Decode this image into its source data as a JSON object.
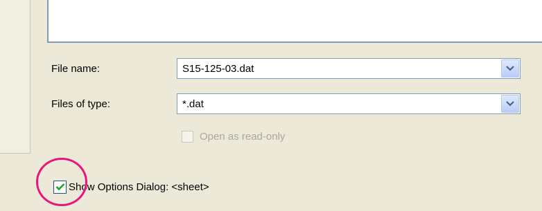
{
  "dialog": {
    "file_name_label": "File name:",
    "file_name_value": "S15-125-03.dat",
    "files_of_type_label": "Files of type:",
    "files_of_type_value": "*.dat",
    "open_readonly_label": "Open as read-only",
    "open_readonly_checked": false,
    "open_readonly_enabled": false,
    "show_options_label": "Show Options Dialog: <sheet>",
    "show_options_checked": true
  },
  "colors": {
    "background": "#ece9d8",
    "field_border": "#7f9db9",
    "dropdown_button": "#c1d3fb",
    "check_mark": "#21a121",
    "highlight_circle": "#e8157f",
    "disabled_text": "#aca899"
  },
  "icons": {
    "dropdown": "chevron-down-icon",
    "check": "check-icon"
  }
}
